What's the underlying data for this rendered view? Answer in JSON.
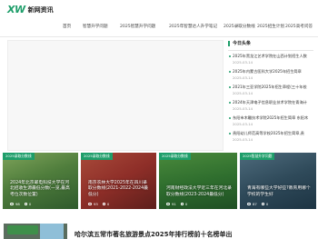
{
  "brand": {
    "mark": "XW",
    "name": "新网资讯"
  },
  "nav": {
    "items": [
      "首页",
      "智慧升学问题",
      "2025智慧升学问题",
      "2025年智慧达人升学笔记",
      "2025录取分数线",
      "2025招生计划",
      "2025高考问答"
    ]
  },
  "sidebar": {
    "title": "今日头条",
    "items": [
      {
        "title": "2025年黑龙江艺术学院在山西计划招生人数",
        "date": "2025-03-14"
      },
      {
        "title": "2025年内蒙古医科大学2025年招生简章",
        "date": "2025-03-14"
      },
      {
        "title": "2021年三亚学院2025年招生章程(三十年校",
        "date": "2025-03-14"
      },
      {
        "title": "2024年天津电子信息职业技术学院在青海计",
        "date": "2025-03-14"
      },
      {
        "title": "东阳市木雕技术学院2025年招生简章 东阳木",
        "date": "2025-03-14"
      },
      {
        "title": "贵阳幼儿师范高等学校2025年招生简章,贵",
        "date": "2025-03-14"
      }
    ]
  },
  "cards": [
    {
      "tag": "2025录取分数线",
      "caption": "2024年北京邮电科技大学在河北招收生源最低分数(一览,最高考位次数位置)",
      "views": "98",
      "comments": "0"
    },
    {
      "tag": "2025录取分数线",
      "caption": "南京农林大学2025年在四川录取分数线(2021-2022-2024最低分)",
      "views": "93",
      "comments": "0"
    },
    {
      "tag": "2025录取分数线",
      "caption": "河南财经政法大学近三年在河北录取分数线(2023-2024最低分)",
      "views": "91",
      "comments": "0"
    },
    {
      "tag": "2025智慧升学问题",
      "caption": "青海有哪些大学好些?教育用哪个学校的学生好",
      "views": "87",
      "comments": "0"
    }
  ],
  "article": {
    "title": "哈尔滨五常市著名旅游景点2025年排行榜前十名榜单出"
  },
  "colors": {
    "accent": "#1e9e6a"
  }
}
